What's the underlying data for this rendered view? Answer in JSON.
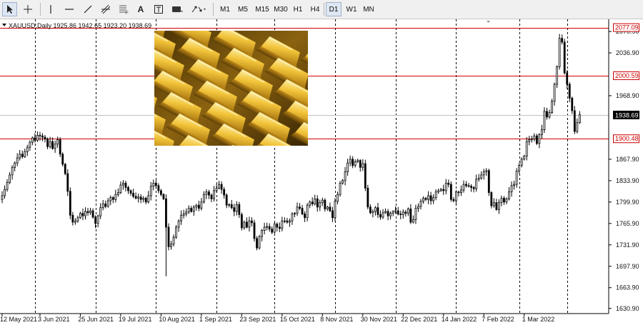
{
  "toolbar": {
    "timeframes": [
      "M1",
      "M5",
      "M15",
      "M30",
      "H1",
      "H4",
      "D1",
      "W1",
      "MN"
    ],
    "active_timeframe": "D1",
    "text_tool": "A"
  },
  "colors": {
    "candle": "#000000",
    "level_line": "#cc0000",
    "level_label_bg": "#cc0000",
    "current_label_bg": "#000000",
    "grid": "#000000"
  },
  "chart_data": {
    "type": "candlestick",
    "symbol_info": "XAUUSD,Daily  1925.86 1942.65 1923.20 1938.69",
    "ylim": [
      1625,
      2088
    ],
    "price_ticks": [
      "2070.90",
      "2036.90",
      "1968.90",
      "1867.90",
      "1833.90",
      "1799.90",
      "1765.90",
      "1731.90",
      "1697.90",
      "1663.90",
      "1630.90"
    ],
    "horizontal_levels": [
      {
        "label": "2077.09",
        "value": 2077.09
      },
      {
        "label": "2000.59",
        "value": 2000.59
      },
      {
        "label": "1900.48",
        "value": 1900.48
      }
    ],
    "current_price": {
      "label": "1938.69",
      "value": 1938.69
    },
    "date_labels": [
      "12 May 2021",
      "3 Jun 2021",
      "25 Jun 2021",
      "19 Jul 2021",
      "10 Aug 2021",
      "1 Sep 2021",
      "23 Sep 2021",
      "15 Oct 2021",
      "8 Nov 2021",
      "30 Nov 2021",
      "22 Dec 2021",
      "14 Jan 2022",
      "7 Feb 2022",
      "1 Mar 2022"
    ],
    "date_label_index": [
      0,
      15,
      31,
      47,
      63,
      79,
      95,
      111,
      127,
      143,
      159,
      175,
      191,
      207
    ],
    "vertical_grid_index": [
      13,
      37,
      61,
      85,
      108,
      132,
      156,
      180,
      205,
      224
    ],
    "closes": [
      1810,
      1820,
      1831,
      1843,
      1855,
      1862,
      1870,
      1876,
      1872,
      1880,
      1887,
      1895,
      1902,
      1898,
      1906,
      1905,
      1903,
      1900,
      1888,
      1896,
      1885,
      1892,
      1899,
      1876,
      1860,
      1845,
      1817,
      1779,
      1768,
      1770,
      1775,
      1782,
      1778,
      1785,
      1783,
      1786,
      1776,
      1766,
      1778,
      1791,
      1797,
      1793,
      1802,
      1807,
      1804,
      1812,
      1815,
      1827,
      1830,
      1823,
      1818,
      1814,
      1809,
      1806,
      1808,
      1804,
      1806,
      1800,
      1810,
      1825,
      1830,
      1826,
      1818,
      1812,
      1805,
      1760,
      1729,
      1733,
      1744,
      1760,
      1770,
      1779,
      1781,
      1784,
      1790,
      1785,
      1792,
      1795,
      1790,
      1800,
      1812,
      1816,
      1811,
      1805,
      1818,
      1822,
      1828,
      1820,
      1811,
      1795,
      1796,
      1791,
      1785,
      1796,
      1780,
      1759,
      1768,
      1760,
      1770,
      1767,
      1742,
      1727,
      1745,
      1755,
      1760,
      1761,
      1757,
      1752,
      1765,
      1760,
      1758,
      1770,
      1770,
      1768,
      1770,
      1781,
      1782,
      1792,
      1790,
      1781,
      1775,
      1795,
      1800,
      1797,
      1805,
      1792,
      1799,
      1803,
      1789,
      1792,
      1786,
      1775,
      1801,
      1812,
      1830,
      1834,
      1848,
      1862,
      1868,
      1858,
      1864,
      1866,
      1855,
      1861,
      1822,
      1792,
      1783,
      1785,
      1791,
      1780,
      1776,
      1783,
      1785,
      1778,
      1782,
      1785,
      1786,
      1781,
      1780,
      1784,
      1782,
      1789,
      1768,
      1772,
      1790,
      1793,
      1801,
      1806,
      1804,
      1810,
      1802,
      1807,
      1816,
      1818,
      1820,
      1818,
      1830,
      1828,
      1804,
      1802,
      1816,
      1815,
      1819,
      1828,
      1826,
      1825,
      1823,
      1821,
      1836,
      1838,
      1843,
      1848,
      1850,
      1815,
      1794,
      1799,
      1788,
      1799,
      1806,
      1800,
      1805,
      1816,
      1826,
      1828,
      1849,
      1858,
      1868,
      1873,
      1896,
      1899,
      1900,
      1905,
      1893,
      1907,
      1915,
      1944,
      1935,
      1942,
      1960,
      1987,
      2015,
      2060,
      2054,
      2005,
      1987,
      1965,
      1945,
      1912,
      1926,
      1938.69
    ]
  }
}
